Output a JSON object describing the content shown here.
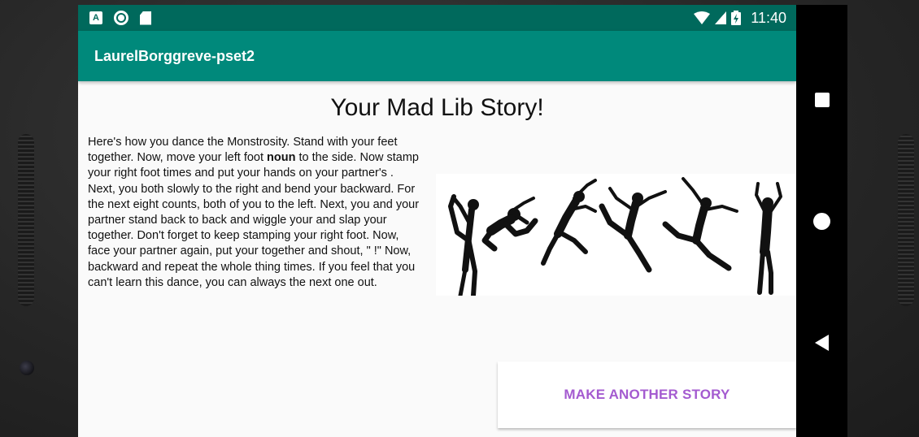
{
  "status_bar": {
    "left_icons": [
      "android-notification-icon",
      "sync-circle-icon",
      "sd-card-icon"
    ],
    "right_icons": [
      "wifi-icon",
      "cell-signal-icon",
      "battery-icon"
    ],
    "a_glyph": "A",
    "time": "11:40"
  },
  "app_bar": {
    "title": "LaurelBorggreve-pset2"
  },
  "main": {
    "title": "Your Mad Lib Story!",
    "story_before": "Here's how you dance the Monstrosity. Stand with your feet together. Now, move your left foot ",
    "story_bold": "noun",
    "story_after": " to the side. Now stamp your right foot times and put your hands on your partner's . Next, you both slowly to the right and bend your backward. For the next eight counts, both of you to the left. Next, you and your partner stand back to back and wiggle your and slap your together. Don't forget to keep stamping your right foot. Now, face your partner again, put your together and shout, \" !\" Now, backward and repeat the whole thing times. If you feel that you can't learn this dance, you can always the next one out.",
    "image": "dancers-silhouettes-image",
    "button_label": "MAKE ANOTHER STORY"
  },
  "nav_bar": {
    "icons": [
      "recents-square-icon",
      "home-circle-icon",
      "back-triangle-icon"
    ]
  },
  "colors": {
    "status_bar": "#00695c",
    "app_bar": "#00897b",
    "button_text": "#a45bd0",
    "background": "#fafafa"
  }
}
